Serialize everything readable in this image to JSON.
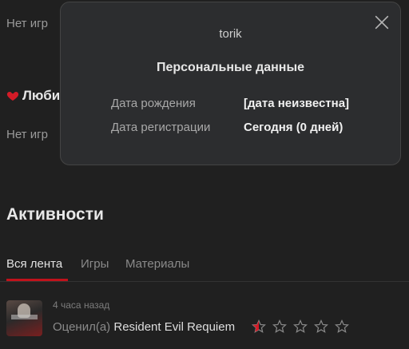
{
  "games": {
    "empty_text": "Нет игр"
  },
  "favorites": {
    "title": "Люби",
    "empty_text": "Нет игр"
  },
  "activities": {
    "title": "Активности",
    "tabs": [
      {
        "label": "Вся лента",
        "active": true
      },
      {
        "label": "Игры",
        "active": false
      },
      {
        "label": "Материалы",
        "active": false
      }
    ],
    "feed": [
      {
        "time": "4 часа назад",
        "action": "Оценил(а)",
        "game": "Resident Evil Requiem",
        "rating": 0.5,
        "max_rating": 5
      }
    ]
  },
  "modal": {
    "username": "torik",
    "section_title": "Персональные данные",
    "rows": [
      {
        "label": "Дата рождения",
        "value": "[дата неизвестна]"
      },
      {
        "label": "Дата регистрации",
        "value": "Сегодня (0 дней)"
      }
    ]
  },
  "colors": {
    "background": "#202020",
    "accent": "#c0121b",
    "modal_bg": "#2c2d2f"
  },
  "icons": {
    "close": "close-icon",
    "heart": "heart-icon",
    "star": "star-icon"
  }
}
